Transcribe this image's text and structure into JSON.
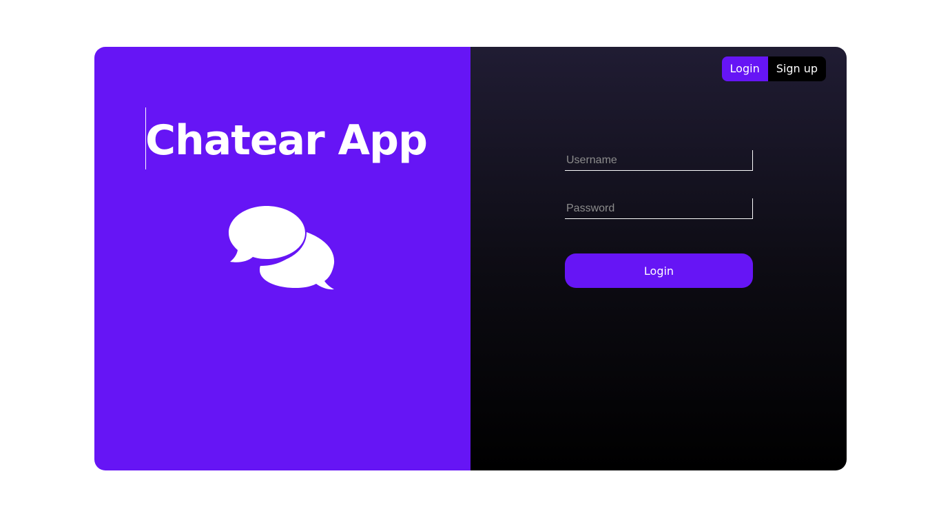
{
  "app": {
    "title": "Chatear App"
  },
  "colors": {
    "accent": "#6615f5",
    "panel_dark_top": "#201c33",
    "panel_dark_bottom": "#000000",
    "placeholder": "#8c8c8c"
  },
  "icons": {
    "hero": "chat-bubbles-icon"
  },
  "auth_tabs": {
    "login_label": "Login",
    "signup_label": "Sign up",
    "active": "Login"
  },
  "form": {
    "username": {
      "placeholder": "Username",
      "value": ""
    },
    "password": {
      "placeholder": "Password",
      "value": ""
    },
    "submit_label": "Login"
  }
}
